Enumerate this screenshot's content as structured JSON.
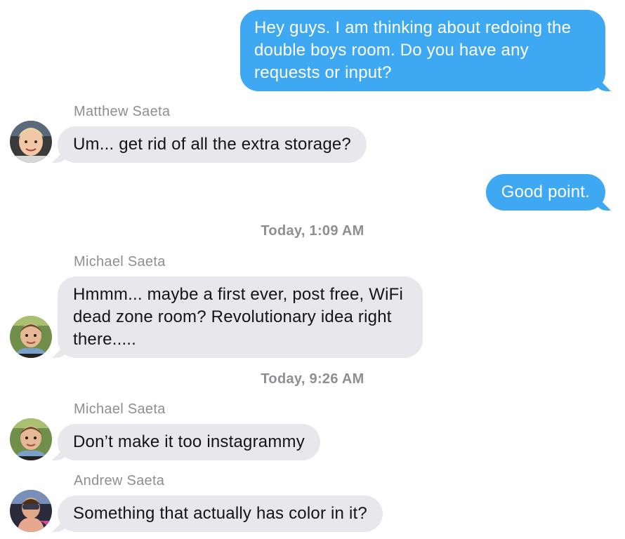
{
  "messages": [
    {
      "direction": "outgoing",
      "text": "Hey guys. I am thinking about redoing the double boys room. Do you have any requests or input?"
    },
    {
      "direction": "incoming",
      "sender": "Matthew Saeta",
      "text": "Um... get rid of all the extra storage?"
    },
    {
      "direction": "outgoing",
      "text": "Good point."
    },
    {
      "type": "timestamp",
      "day": "Today,",
      "time": "1:09 AM"
    },
    {
      "direction": "incoming",
      "sender": "Michael Saeta",
      "text": "Hmmm... maybe a first ever, post free, WiFi dead zone room? Revolutionary idea right there....."
    },
    {
      "type": "timestamp",
      "day": "Today,",
      "time": "9:26 AM"
    },
    {
      "direction": "incoming",
      "sender": "Michael Saeta",
      "text": "Don’t make it too instagrammy"
    },
    {
      "direction": "incoming",
      "sender": "Andrew Saeta",
      "text": "Something that actually has color in it?"
    }
  ],
  "colors": {
    "outgoing_bubble": "#3fa8f3",
    "incoming_bubble": "#e7e7ec",
    "meta_text": "#8e8e93"
  },
  "avatars": [
    "avatar-matthew-photo",
    "avatar-michael-photo",
    "avatar-michael-photo",
    "avatar-andrew-photo"
  ]
}
